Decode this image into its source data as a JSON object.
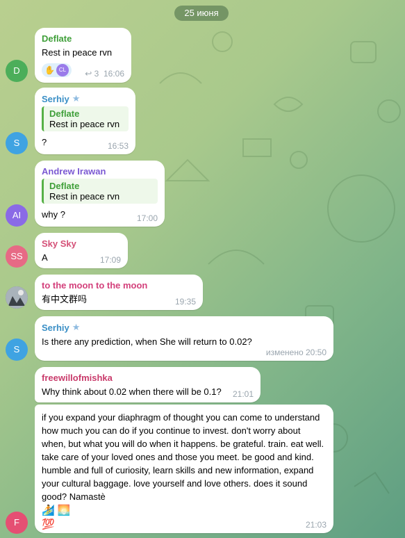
{
  "date_label": "25 июня",
  "colors": {
    "deflate": "#3f9f39",
    "serhiy": "#3a8fc6",
    "andrew": "#7b59d3",
    "sky": "#d45077",
    "moon": "#d3407b",
    "freewill": "#c93b6b",
    "avatar_d": "#4cae5a",
    "avatar_s": "#3fa3e2",
    "avatar_ai": "#8a6ae6",
    "avatar_ss": "#e76a85",
    "avatar_f": "#e54f73"
  },
  "messages": [
    {
      "author": "Deflate",
      "avatar": "D",
      "text": "Rest in peace rvn",
      "reply_count": "3",
      "time": "16:06",
      "reaction_user": "CL",
      "icons": [
        "hand-pointing-icon",
        "reply-icon"
      ]
    },
    {
      "author": "Serhiy",
      "avatar": "S",
      "quote_author": "Deflate",
      "quote_text": "Rest in peace rvn",
      "text": "?",
      "time": "16:53"
    },
    {
      "author": "Andrew Irawan",
      "avatar": "AI",
      "quote_author": "Deflate",
      "quote_text": "Rest in peace rvn",
      "text": "why ?",
      "time": "17:00"
    },
    {
      "author": "Sky Sky",
      "avatar": "SS",
      "text": "A",
      "time": "17:09"
    },
    {
      "author": "to the moon to the moon",
      "text": "有中文群吗",
      "time": "19:35"
    },
    {
      "author": "Serhiy",
      "avatar": "S",
      "text": "Is there any prediction, when She will return to 0.02?",
      "edited": "изменено",
      "time": "20:50"
    },
    {
      "author": "freewillofmishka",
      "text": "Why think about 0.02 when there will be 0.1?",
      "time": "21:01"
    },
    {
      "avatar": "F",
      "text": "if you expand your diaphragm of thought you can come to understand how much you can do if you continue to invest. don't worry about when, but what you will do when it happens. be grateful. train. eat well. take care of your loved ones and those you meet. be good and kind. humble and full of curiosity, learn skills and new information, expand your cultural baggage. love yourself and love others. does it sound good? Namastè",
      "emoji_line1": "🏄 🌅",
      "emoji_line2": "💯",
      "time": "21:03"
    }
  ]
}
